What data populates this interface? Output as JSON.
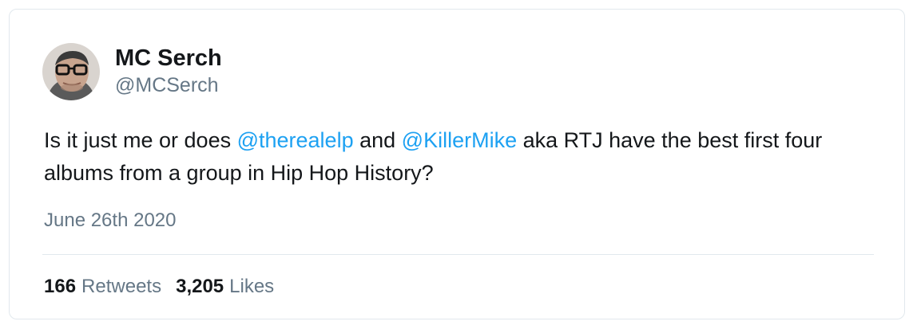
{
  "tweet": {
    "author": {
      "display_name": "MC Serch",
      "handle": "@MCSerch",
      "avatar_icon": "profile-photo"
    },
    "text": {
      "part1": "Is it just me or does ",
      "mention1": "@therealelp",
      "part2": " and ",
      "mention2": "@KillerMike",
      "part3": " aka RTJ have the best first four albums from a group in Hip Hop History?"
    },
    "date": "June 26th 2020",
    "stats": {
      "retweets_count": "166",
      "retweets_label": "Retweets",
      "likes_count": "3,205",
      "likes_label": "Likes"
    }
  },
  "colors": {
    "mention": "#1da1f2",
    "secondary_text": "#657786",
    "border": "#e1e8ed"
  }
}
